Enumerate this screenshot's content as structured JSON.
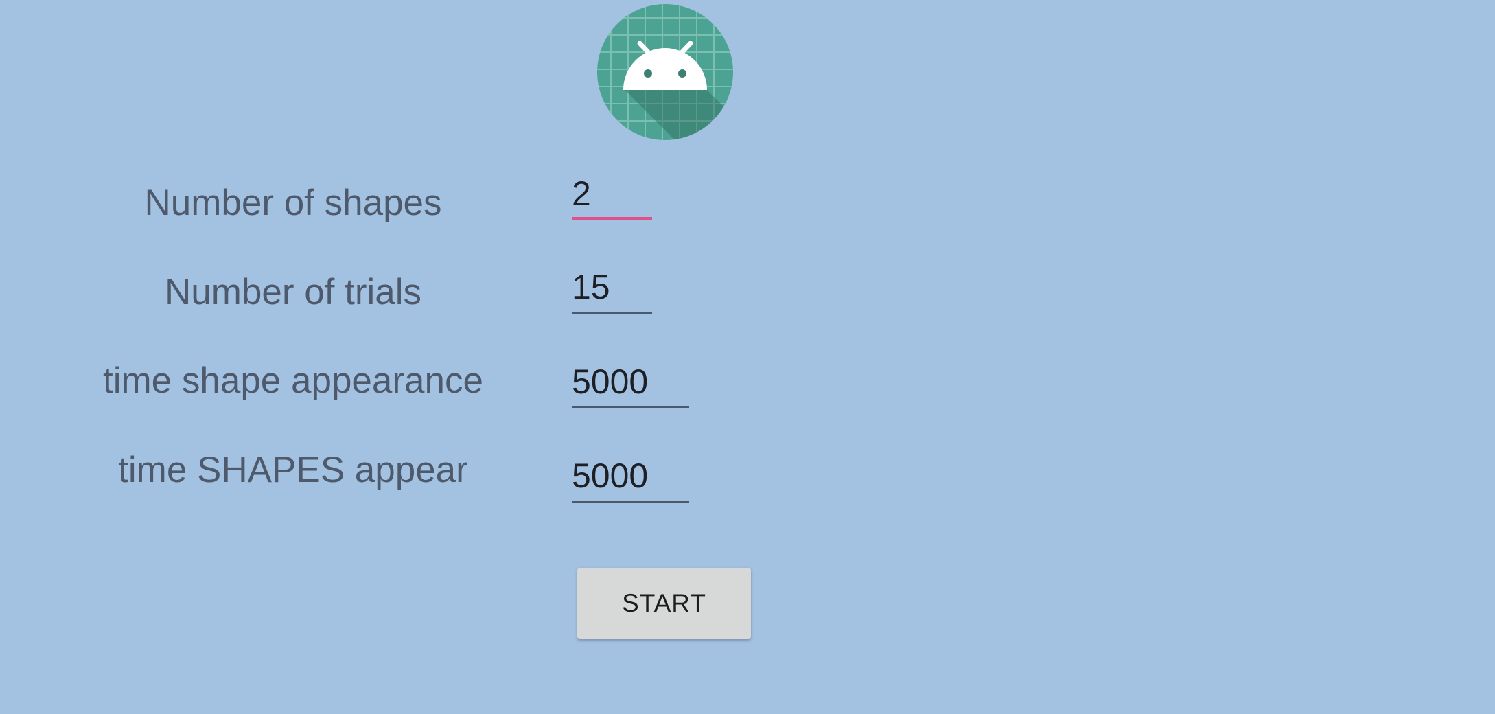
{
  "app": {
    "icon": "android-robot-icon"
  },
  "form": {
    "rows": [
      {
        "label": "Number of shapes",
        "value": "2"
      },
      {
        "label": "Number of trials",
        "value": "15"
      },
      {
        "label": "time shape appearance",
        "value": "5000"
      },
      {
        "label": "time SHAPES appear",
        "value": "5000"
      }
    ],
    "focused_field_index": 0
  },
  "actions": {
    "start_label": "START"
  },
  "colors": {
    "background": "#a3c1e1",
    "icon_background": "#4da393",
    "focus_accent": "#e0508a",
    "button_background": "#d7d8d8"
  }
}
